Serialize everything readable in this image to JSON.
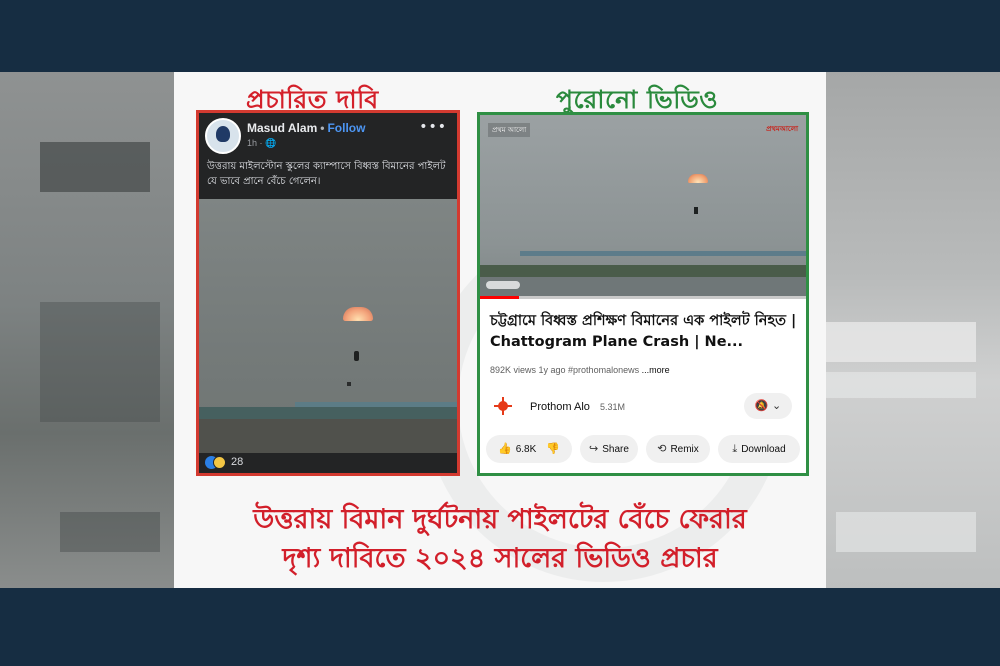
{
  "colors": {
    "frame": "#162d42",
    "claim_red": "#d4202a",
    "old_green": "#2a8a3c",
    "fb_bg": "#232425",
    "follow_blue": "#4d96f3"
  },
  "headings": {
    "claim": "প্রচারিত দাবি",
    "old_video": "পুরোনো ভিডিও"
  },
  "facebook_post": {
    "author": "Masud Alam",
    "separator": "•",
    "follow": "Follow",
    "meta": "1h · 🌐",
    "more_icon": "•••",
    "text": "উত্তরায় মাইলস্টোন স্কুলের ক্যাম্পাসে বিধ্বস্ত বিমানের পাইলট যে ভাবে প্রানে বেঁচে গেলেন।",
    "reaction_count": "28"
  },
  "youtube": {
    "video_tag": "প্রথম আলো",
    "video_logo": "প্রথমআলো",
    "progress": 0.12,
    "title": "চট্টগ্রামে বিধ্বস্ত প্রশিক্ষণ বিমানের এক পাইলট নিহত | Chattogram Plane Crash | Ne...",
    "stats": "892K views  1y ago  #prothomalonews",
    "more": "...more",
    "channel": "Prothom Alo",
    "subscribers": "5.31M",
    "bell_icon": "🔕 ⌄",
    "actions": {
      "like": "6.8K",
      "share": "Share",
      "remix": "Remix",
      "download": "Download"
    }
  },
  "bottom_caption": {
    "line1": "উত্তরায় বিমান দুর্ঘটনায় পাইলটের বেঁচে ফেরার",
    "line2": "দৃশ্য দাবিতে ২০২৪ সালের ভিডিও প্রচার"
  }
}
